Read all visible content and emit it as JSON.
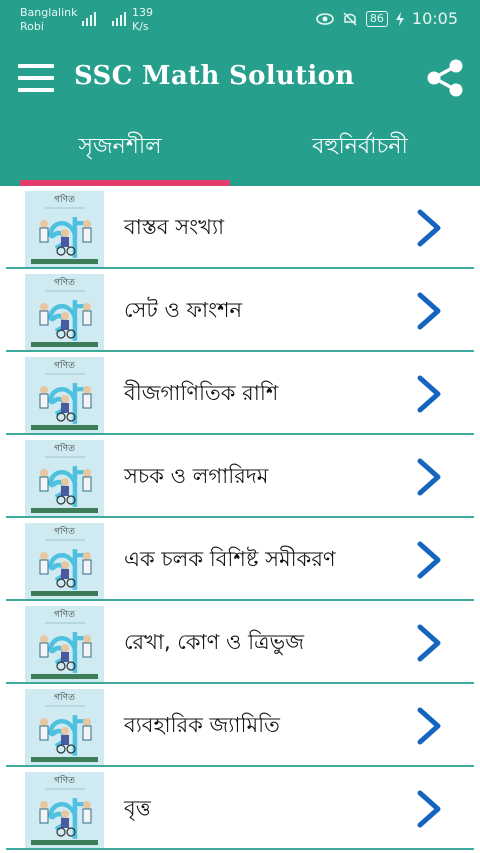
{
  "status_bar": {
    "carrier1": "Banglalink",
    "carrier2": "Robi",
    "speed_value": "139",
    "speed_unit": "K/s",
    "battery": "86",
    "time": "10:05"
  },
  "app_bar": {
    "title": "SSC Math Solution"
  },
  "tabs": [
    {
      "label": "সৃজনশীল",
      "selected": true
    },
    {
      "label": "বহুনির্বাচনী",
      "selected": false
    }
  ],
  "book_cover": {
    "title": "গণিত",
    "big_letter": "গ"
  },
  "chapters": [
    {
      "label": "বাস্তব সংখ্যা"
    },
    {
      "label": "সেট ও ফাংশন"
    },
    {
      "label": "বীজগাণিতিক রাশি"
    },
    {
      "label": "সচক ও লগারিদম"
    },
    {
      "label": "এক চলক বিশিষ্ট সমীকরণ"
    },
    {
      "label": "রেখা, কোণ ও ত্রিভুজ"
    },
    {
      "label": "ব্যবহারিক জ্যামিতি"
    },
    {
      "label": "বৃত্ত"
    }
  ],
  "colors": {
    "primary": "#26a08c",
    "tab_indicator": "#e33d6c",
    "chevron": "#1565c0"
  }
}
